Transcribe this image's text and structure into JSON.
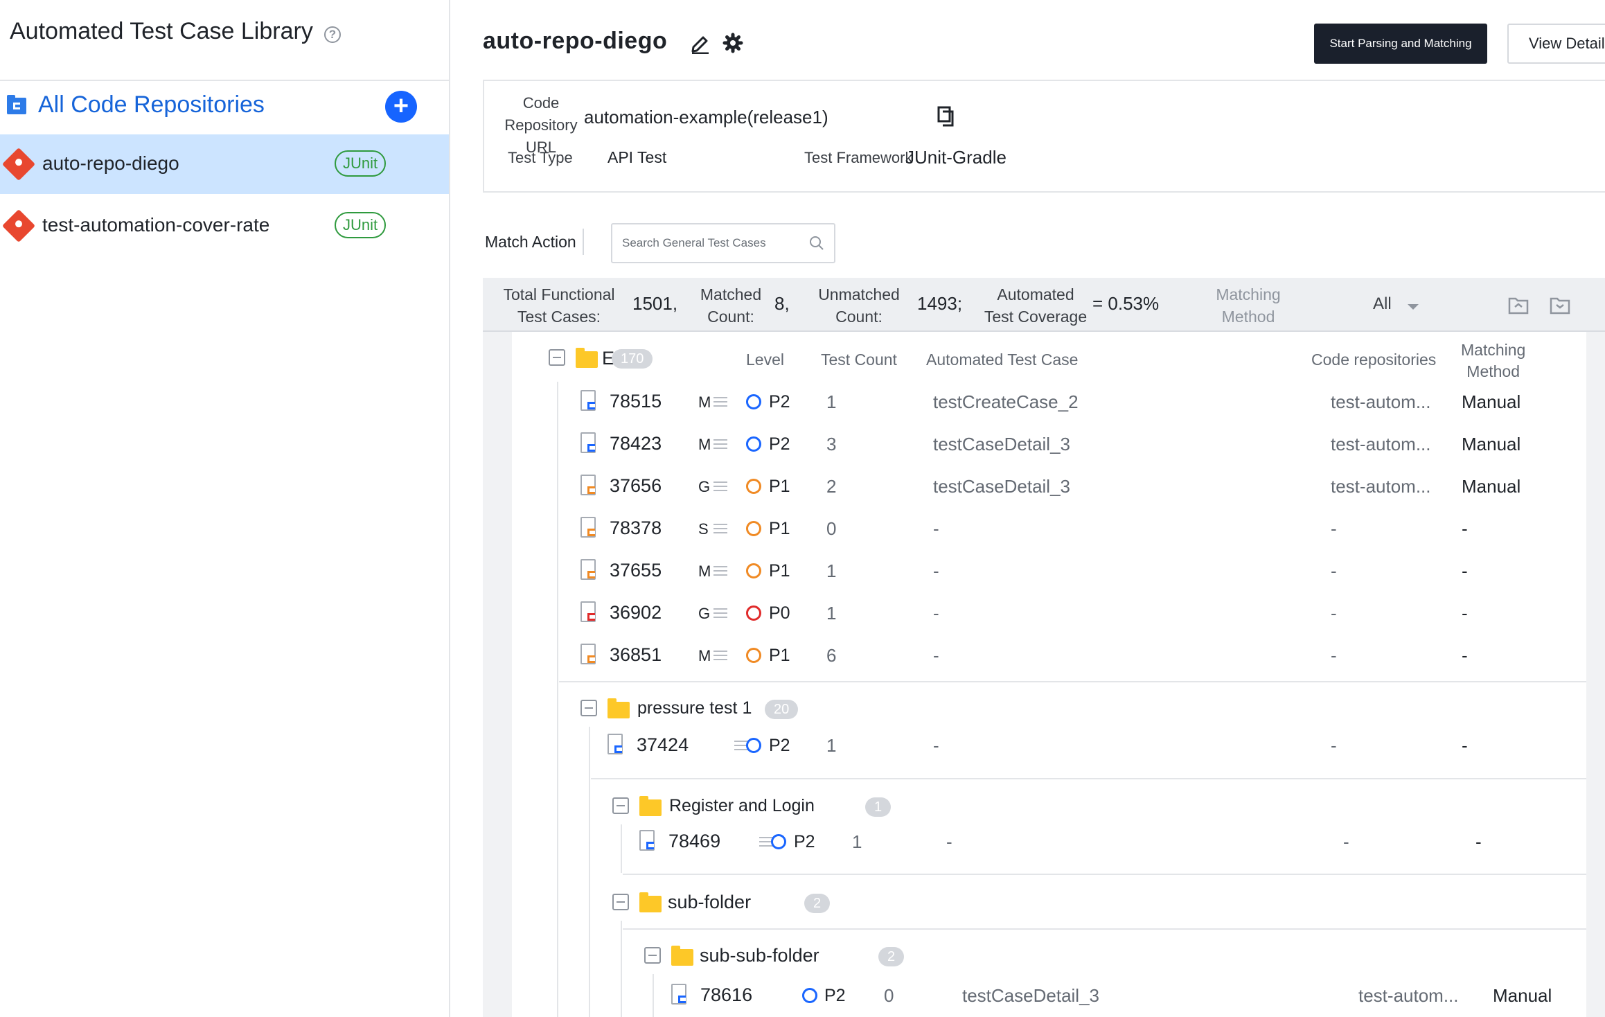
{
  "sidebar": {
    "title": "Automated Test Case Library",
    "all_repos_label": "All Code Repositories",
    "repos": [
      {
        "name": "auto-repo-diego",
        "badge": "JUnit",
        "selected": true
      },
      {
        "name": "test-automation-cover-rate",
        "badge": "JUnit",
        "selected": false
      }
    ]
  },
  "header": {
    "repo_title": "auto-repo-diego",
    "start_button": "Start Parsing and Matching",
    "view_button": "View Details"
  },
  "info": {
    "url_label_1": "Code",
    "url_label_2": "Repository URL",
    "url_value": "automation-example(release1)",
    "test_type_label": "Test Type",
    "test_type_value": "API Test",
    "framework_label": "Test Framework",
    "framework_value": "JUnit-Gradle"
  },
  "filters": {
    "match_action": "Match Action",
    "search_placeholder": "Search General Test Cases"
  },
  "stats": {
    "total_label_1": "Total Functional",
    "total_label_2": "Test Cases:",
    "total_value": "1501,",
    "matched_label_1": "Matched",
    "matched_label_2": "Count:",
    "matched_value": "8,",
    "unmatched_label_1": "Unmatched",
    "unmatched_label_2": "Count:",
    "unmatched_value": "1493;",
    "coverage_label_1": "Automated",
    "coverage_label_2": "Test Coverage",
    "coverage_value": "= 0.53%",
    "method_label_1": "Matching",
    "method_label_2": "Method",
    "method_value": "All"
  },
  "columns": {
    "level": "Level",
    "test_count": "Test Count",
    "automated": "Automated Test Case",
    "repos": "Code repositories",
    "method_1": "Matching",
    "method_2": "Method"
  },
  "tree": {
    "root": {
      "name": "E",
      "count": "170"
    },
    "root_rows": [
      {
        "id": "78515",
        "type": "M",
        "priority": "P2",
        "color": "#1a66ff",
        "count": "1",
        "auto": "testCreateCase_2",
        "repo": "test-autom...",
        "method": "Manual"
      },
      {
        "id": "78423",
        "type": "M",
        "priority": "P2",
        "color": "#1a66ff",
        "count": "3",
        "auto": "testCaseDetail_3",
        "repo": "test-autom...",
        "method": "Manual"
      },
      {
        "id": "37656",
        "type": "G",
        "priority": "P1",
        "color": "#f08a24",
        "count": "2",
        "auto": "testCaseDetail_3",
        "repo": "test-autom...",
        "method": "Manual"
      },
      {
        "id": "78378",
        "type": "S",
        "priority": "P1",
        "color": "#f08a24",
        "count": "0",
        "auto": "-",
        "repo": "-",
        "method": "-"
      },
      {
        "id": "37655",
        "type": "M",
        "priority": "P1",
        "color": "#f08a24",
        "count": "1",
        "auto": "-",
        "repo": "-",
        "method": "-"
      },
      {
        "id": "36902",
        "type": "G",
        "priority": "P0",
        "color": "#e02b2b",
        "count": "1",
        "auto": "-",
        "repo": "-",
        "method": "-"
      },
      {
        "id": "36851",
        "type": "M",
        "priority": "P1",
        "color": "#f08a24",
        "count": "6",
        "auto": "-",
        "repo": "-",
        "method": "-"
      }
    ],
    "pressure": {
      "name": "pressure test 1",
      "count": "20"
    },
    "pressure_row": {
      "id": "37424",
      "priority": "P2",
      "count": "1",
      "auto": "-",
      "repo": "-",
      "method": "-"
    },
    "register": {
      "name": "Register and Login",
      "count": "1"
    },
    "register_row": {
      "id": "78469",
      "priority": "P2",
      "count": "1",
      "auto": "-",
      "repo": "-",
      "method": "-"
    },
    "subfolder": {
      "name": "sub-folder",
      "count": "2"
    },
    "subsub": {
      "name": "sub-sub-folder",
      "count": "2"
    },
    "subsub_row": {
      "id": "78616",
      "priority": "P2",
      "count": "0",
      "auto": "testCaseDetail_3",
      "repo": "test-autom...",
      "method": "Manual"
    }
  }
}
